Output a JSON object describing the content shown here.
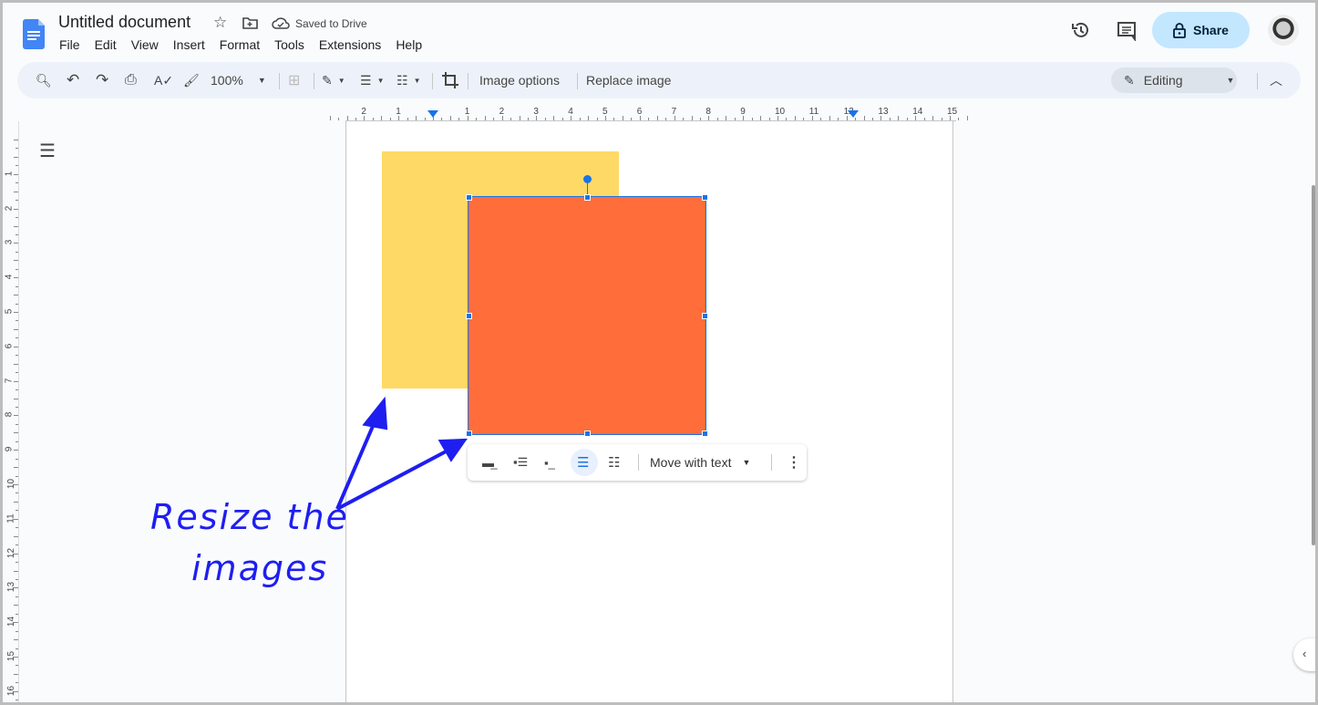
{
  "header": {
    "doc_title": "Untitled document",
    "save_status": "Saved to Drive",
    "share_label": "Share"
  },
  "menu": [
    "File",
    "Edit",
    "View",
    "Insert",
    "Format",
    "Tools",
    "Extensions",
    "Help"
  ],
  "toolbar": {
    "zoom": "100%",
    "image_options": "Image options",
    "replace_image": "Replace image",
    "mode": "Editing"
  },
  "ruler": {
    "h": [
      "2",
      "1",
      "1",
      "2",
      "3",
      "4",
      "5",
      "6",
      "7",
      "8",
      "9",
      "10",
      "11",
      "12",
      "13",
      "14",
      "15"
    ],
    "v": [
      "1",
      "2",
      "3",
      "4",
      "5",
      "6",
      "7",
      "8",
      "9",
      "10",
      "11",
      "12",
      "13",
      "14",
      "15",
      "16"
    ]
  },
  "image_toolbar": {
    "wrap_label": "Move with text"
  },
  "annotation": {
    "line1": "Resize the",
    "line2": "images"
  },
  "colors": {
    "yellow_image": "#ffd966",
    "orange_image": "#ff6d3b",
    "accent": "#1a73e8",
    "annotation": "#1e1ef0"
  }
}
